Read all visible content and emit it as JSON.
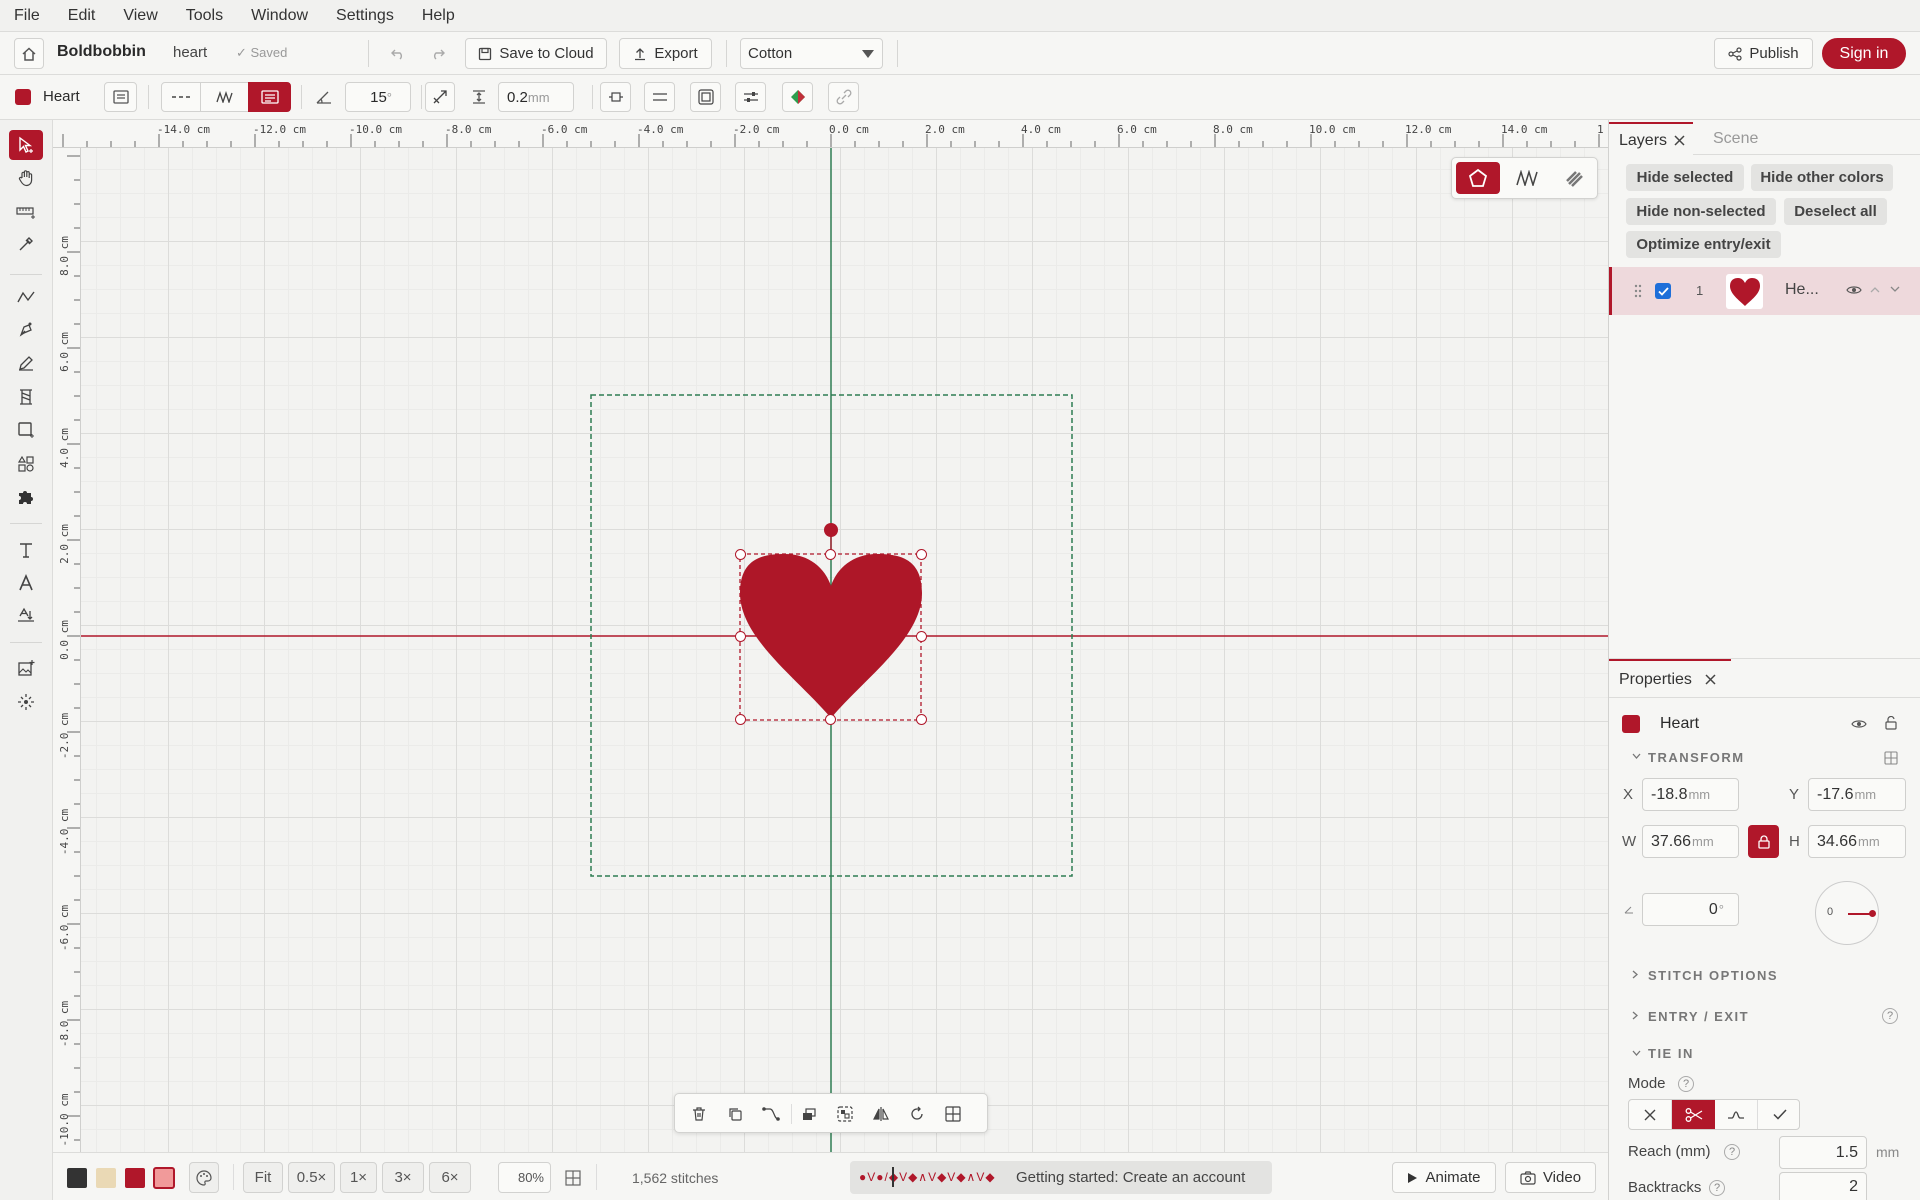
{
  "menu": [
    "File",
    "Edit",
    "View",
    "Tools",
    "Window",
    "Settings",
    "Help"
  ],
  "title": {
    "app": "Boldbobbin",
    "doc": "heart",
    "status": "Saved",
    "save_cloud": "Save to Cloud",
    "export": "Export",
    "fabric": "Cotton",
    "publish": "Publish",
    "signin": "Sign in"
  },
  "toolbar": {
    "object_name": "Heart",
    "angle": "15",
    "angle_unit": "°",
    "spacing": "0.2",
    "spacing_unit": "mm",
    "object_color": "#b0172a"
  },
  "ruler": {
    "h": [
      "-14.0 cm",
      "-12.0 cm",
      "-10.0 cm",
      "-8.0 cm",
      "-6.0 cm",
      "-4.0 cm",
      "-2.0 cm",
      "0.0 cm",
      "2.0 cm",
      "4.0 cm",
      "6.0 cm",
      "8.0 cm",
      "10.0 cm",
      "12.0 cm",
      "14.0 cm",
      "1"
    ],
    "v": [
      "8.0 cm",
      "6.0 cm",
      "4.0 cm",
      "2.0 cm",
      "0.0 cm",
      "-2.0 cm",
      "-4.0 cm",
      "-6.0 cm",
      "-8.0 cm",
      "-10.0 cm"
    ]
  },
  "layers": {
    "tab": "Layers",
    "tab2": "Scene",
    "buttons": [
      "Hide selected",
      "Hide other colors",
      "Hide non-selected",
      "Deselect all",
      "Optimize entry/exit"
    ],
    "items": [
      {
        "index": "1",
        "name": "He...",
        "checked": true
      }
    ]
  },
  "properties": {
    "tab": "Properties",
    "name": "Heart",
    "transform": "TRANSFORM",
    "x_label": "X",
    "x": "-18.8",
    "y_label": "Y",
    "y": "-17.6",
    "w_label": "W",
    "w": "37.66",
    "h_label": "H",
    "h": "34.66",
    "unit": "mm",
    "rotation": "0",
    "rotation_unit": "°",
    "dial": "0",
    "stitch_options": "STITCH OPTIONS",
    "entry_exit": "ENTRY / EXIT",
    "tie_in": "TIE IN",
    "mode": "Mode",
    "reach_label": "Reach (mm)",
    "reach": "1.5",
    "reach_unit": "mm",
    "backtracks_label": "Backtracks",
    "backtracks": "2"
  },
  "bottom": {
    "colors": [
      "#333333",
      "#ead9b5",
      "#b0172a",
      "#f19a9a"
    ],
    "fit": "Fit",
    "zooms": [
      "0.5×",
      "1×",
      "3×",
      "6×"
    ],
    "zoom": "80%",
    "stitches": "1,562 stitches",
    "preview": "●V●/◆V◆∧V◆V◆∧V◆",
    "hint": "Getting started: Create an account",
    "animate": "Animate",
    "video": "Video"
  },
  "colors": {
    "accent": "#b0172a",
    "guide_green": "#2e7d52"
  }
}
